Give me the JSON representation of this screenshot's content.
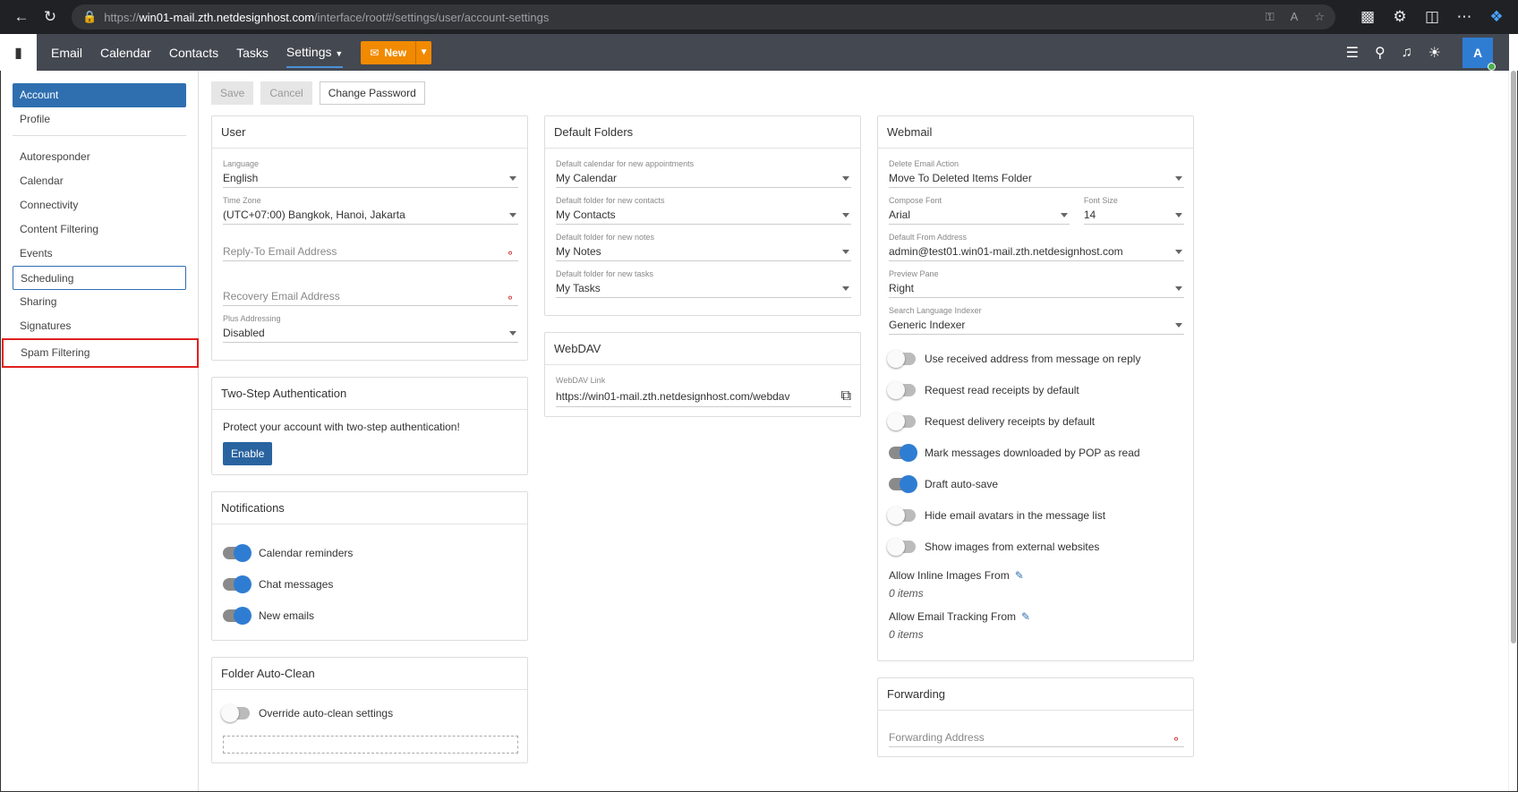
{
  "browser": {
    "url_prefix": "https://",
    "url_host": "win01-mail.zth.netdesignhost.com",
    "url_path": "/interface/root#/settings/user/account-settings"
  },
  "appbar": {
    "nav": [
      "Email",
      "Calendar",
      "Contacts",
      "Tasks",
      "Settings"
    ],
    "new_label": "New",
    "avatar": "A"
  },
  "toolbar": {
    "save": "Save",
    "cancel": "Cancel",
    "change_password": "Change Password"
  },
  "sidebar": {
    "items": [
      "Account",
      "Profile",
      "Autoresponder",
      "Calendar",
      "Connectivity",
      "Content Filtering",
      "Events",
      "Scheduling",
      "Sharing",
      "Signatures",
      "Spam Filtering"
    ]
  },
  "user": {
    "title": "User",
    "language_label": "Language",
    "language": "English",
    "timezone_label": "Time Zone",
    "timezone": "(UTC+07:00) Bangkok, Hanoi, Jakarta",
    "reply_to_placeholder": "Reply-To Email Address",
    "recovery_placeholder": "Recovery Email Address",
    "plus_label": "Plus Addressing",
    "plus": "Disabled"
  },
  "twostep": {
    "title": "Two-Step Authentication",
    "text": "Protect your account with two-step authentication!",
    "button": "Enable"
  },
  "notifications": {
    "title": "Notifications",
    "items": [
      "Calendar reminders",
      "Chat messages",
      "New emails"
    ]
  },
  "autoclean": {
    "title": "Folder Auto-Clean",
    "override": "Override auto-clean settings"
  },
  "folders": {
    "title": "Default Folders",
    "cal_label": "Default calendar for new appointments",
    "cal": "My Calendar",
    "contacts_label": "Default folder for new contacts",
    "contacts": "My Contacts",
    "notes_label": "Default folder for new notes",
    "notes": "My Notes",
    "tasks_label": "Default folder for new tasks",
    "tasks": "My Tasks"
  },
  "webdav": {
    "title": "WebDAV",
    "link_label": "WebDAV Link",
    "link": "https://win01-mail.zth.netdesignhost.com/webdav"
  },
  "webmail": {
    "title": "Webmail",
    "delete_label": "Delete Email Action",
    "delete": "Move To Deleted Items Folder",
    "font_label": "Compose Font",
    "font": "Arial",
    "size_label": "Font Size",
    "size": "14",
    "from_label": "Default From Address",
    "from": "admin@test01.win01-mail.zth.netdesignhost.com",
    "preview_label": "Preview Pane",
    "preview": "Right",
    "indexer_label": "Search Language Indexer",
    "indexer": "Generic Indexer",
    "toggles": [
      "Use received address from message on reply",
      "Request read receipts by default",
      "Request delivery receipts by default",
      "Mark messages downloaded by POP as read",
      "Draft auto-save",
      "Hide email avatars in the message list",
      "Show images from external websites"
    ],
    "inline_label": "Allow Inline Images From",
    "inline_count": "0 items",
    "tracking_label": "Allow Email Tracking From",
    "tracking_count": "0 items"
  },
  "forwarding": {
    "title": "Forwarding",
    "placeholder": "Forwarding Address"
  }
}
